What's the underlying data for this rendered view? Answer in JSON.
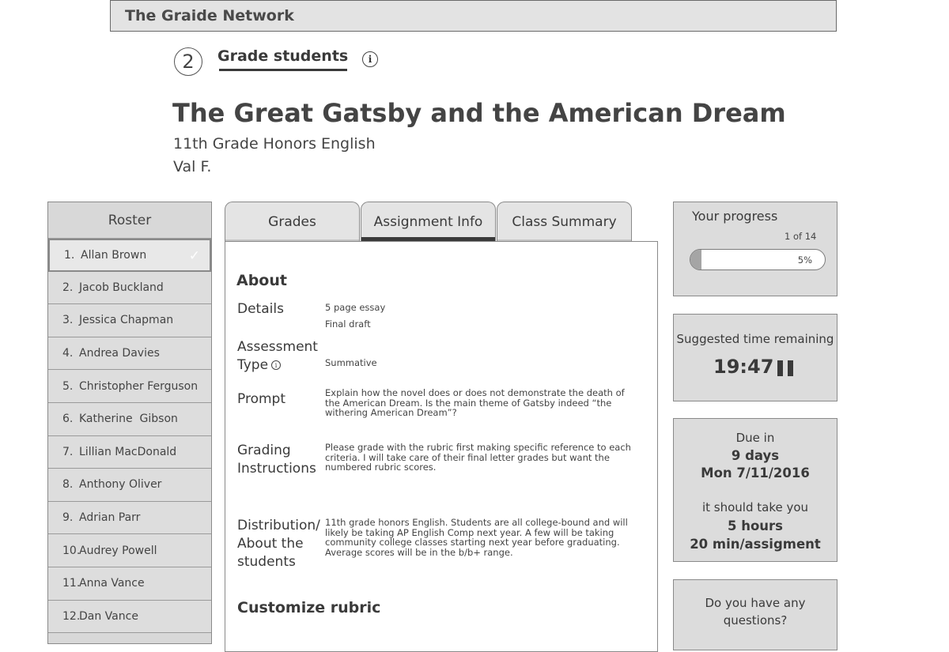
{
  "app": {
    "title": "The Graide Network"
  },
  "step": {
    "number": "2",
    "title": "Grade students",
    "info_icon": "info-icon"
  },
  "assignment": {
    "title": "The Great Gatsby and the American Dream",
    "course": "11th Grade Honors English",
    "teacher": "Val F."
  },
  "roster": {
    "header": "Roster",
    "items": [
      {
        "num": "1.",
        "name": "Allan Brown",
        "selected": true,
        "checked": true
      },
      {
        "num": "2.",
        "name": "Jacob Buckland"
      },
      {
        "num": "3.",
        "name": "Jessica Chapman"
      },
      {
        "num": "4.",
        "name": "Andrea Davies"
      },
      {
        "num": "5.",
        "name": "Christopher Ferguson"
      },
      {
        "num": "6.",
        "name": "Katherine  Gibson"
      },
      {
        "num": "7.",
        "name": "Lillian MacDonald"
      },
      {
        "num": "8.",
        "name": "Anthony Oliver"
      },
      {
        "num": "9.",
        "name": "Adrian Parr"
      },
      {
        "num": "10.",
        "name": "Audrey Powell"
      },
      {
        "num": "11.",
        "name": "Anna Vance"
      },
      {
        "num": "12.",
        "name": "Dan Vance"
      }
    ]
  },
  "tabs": [
    {
      "label": "Grades",
      "active": false
    },
    {
      "label": "Assignment Info",
      "active": true
    },
    {
      "label": "Class Summary",
      "active": false
    }
  ],
  "about": {
    "heading": "About",
    "details_label": "Details",
    "details_values": [
      "5 page essay",
      "Final draft"
    ],
    "assessment_label_1": "Assessment",
    "assessment_label_2": "Type",
    "assessment_value": "Summative",
    "prompt_label": "Prompt",
    "prompt_lines": [
      "Explain how the novel does or does not demonstrate the death of",
      "the American Dream. Is the main theme of Gatsby indeed “the",
      "withering American Dream”?"
    ],
    "grading_label_1": "Grading",
    "grading_label_2": "Instructions",
    "grading_lines": [
      "Please grade with the rubric first making specific reference to each",
      "criteria. I will take care of their final letter grades but want the",
      "numbered rubric scores."
    ],
    "distribution_label_1": "Distribution/",
    "distribution_label_2": "About the",
    "distribution_label_3": "students",
    "distribution_lines": [
      "11th grade honors English. Students are all college-bound and will",
      "likely be taking AP English Comp next year. A few will be taking",
      "community college classes starting next year before graduating.",
      "Average scores will be in the b/b+ range."
    ],
    "rubric_heading": "Customize rubric"
  },
  "progress": {
    "title": "Your progress",
    "count": "1 of 14",
    "percent_label": "5%",
    "percent": 5
  },
  "time": {
    "label": "Suggested time remaining",
    "value": "19:47",
    "icon": "pause-icon"
  },
  "due": {
    "label": "Due in",
    "days": "9 days",
    "date": "Mon 7/11/2016",
    "take_label": "it should take you",
    "hours": "5 hours",
    "per": "20 min/assigment"
  },
  "questions": {
    "line1": "Do you have any",
    "line2": "questions?"
  },
  "colors": {
    "bar_bg": "#e3e3e3",
    "panel_bg": "#d8d8d8",
    "active_tab_line": "#3a3a3a",
    "inactive_tab_line": "#c4c4c4",
    "progress_fill": "#a5a5a5"
  }
}
